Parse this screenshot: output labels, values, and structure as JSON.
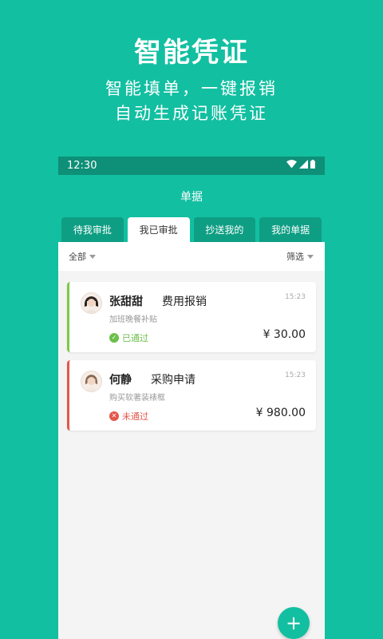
{
  "promo": {
    "title": "智能凭证",
    "subtitle_line1": "智能填单，一键报销",
    "subtitle_line2": "自动生成记账凭证"
  },
  "status_bar": {
    "time": "12:30"
  },
  "app_bar": {
    "title": "单据"
  },
  "tabs": [
    {
      "label": "待我审批",
      "active": false
    },
    {
      "label": "我已审批",
      "active": true
    },
    {
      "label": "抄送我的",
      "active": false
    },
    {
      "label": "我的单据",
      "active": false
    }
  ],
  "filters": {
    "scope": "全部",
    "filter": "筛选"
  },
  "cards": [
    {
      "name": "张甜甜",
      "type": "费用报销",
      "time": "15:23",
      "desc": "加班晚餐补贴",
      "status": "已通过",
      "status_color": "#6cc04a",
      "amount": "¥ 30.00"
    },
    {
      "name": "何静",
      "type": "采购申请",
      "time": "15:23",
      "desc": "购买软著装裱框",
      "status": "未通过",
      "status_color": "#e2574c",
      "amount": "¥ 980.00"
    }
  ],
  "fab": {
    "icon": "plus-icon",
    "symbol": "+"
  },
  "colors": {
    "brand": "#12bfa1",
    "brand_dark": "#0e8f77"
  }
}
